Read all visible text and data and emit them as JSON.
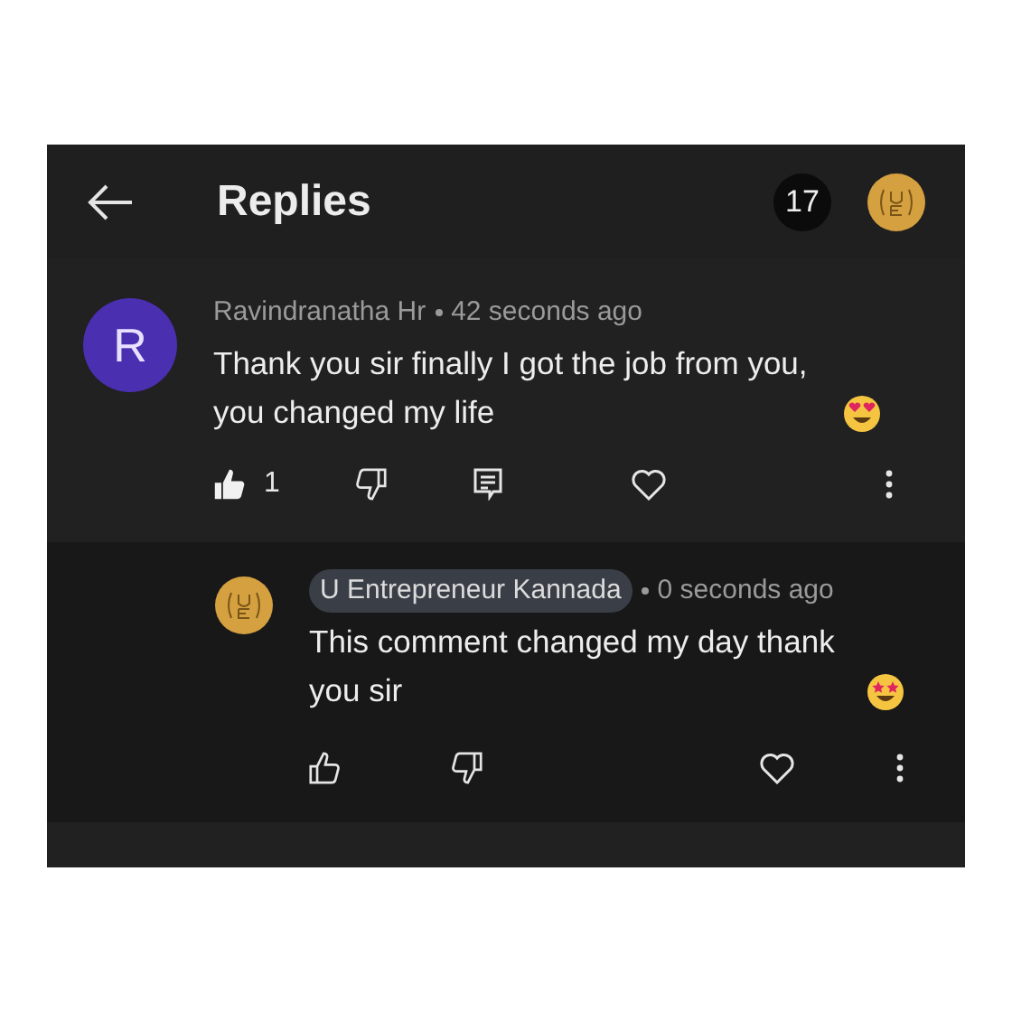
{
  "header": {
    "title": "Replies",
    "count": "17"
  },
  "comments": [
    {
      "kind": "comment",
      "avatar_letter": "R",
      "author": "Ravindranatha Hr",
      "is_creator": false,
      "time": "42 seconds ago",
      "text": "Thank you sir finally I got the job from you, you changed my life",
      "liked": true,
      "like_count": "1"
    },
    {
      "kind": "reply",
      "author": "U Entrepreneur Kannada",
      "is_creator": true,
      "time": "0 seconds ago",
      "text": "This comment changed my day thank you sir",
      "liked": false
    }
  ]
}
